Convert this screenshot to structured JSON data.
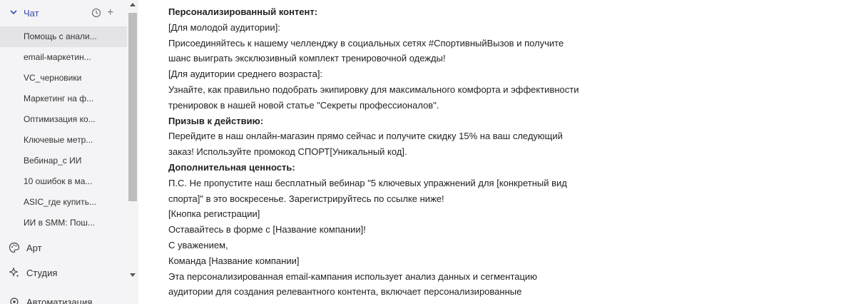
{
  "sidebar": {
    "chat_label": "Чат",
    "chat_items": [
      {
        "label": "Помощь с анали...",
        "active": true
      },
      {
        "label": "email-маркетин..."
      },
      {
        "label": "VC_черновики"
      },
      {
        "label": "Маркетинг на ф..."
      },
      {
        "label": "Оптимизация ко..."
      },
      {
        "label": "Ключевые метр..."
      },
      {
        "label": "Вебинар_с ИИ"
      },
      {
        "label": "10 ошибок в ма..."
      },
      {
        "label": "ASIC_где купить..."
      },
      {
        "label": "ИИ в SMM: Пош..."
      }
    ],
    "nav": [
      {
        "label": "Арт",
        "icon": "palette-icon"
      },
      {
        "label": "Студия",
        "icon": "sparkle-icon"
      },
      {
        "label": "Автоматизация",
        "icon": "automation-icon"
      }
    ]
  },
  "content": {
    "lines": [
      {
        "text": "Персонализированный контент:",
        "bold": true
      },
      {
        "text": "[Для молодой аудитории]:"
      },
      {
        "text": "Присоединяйтесь к нашему челленджу в социальных сетях #СпортивныйВызов и получите"
      },
      {
        "text": "шанс выиграть эксклюзивный комплект тренировочной одежды!"
      },
      {
        "text": "[Для аудитории среднего возраста]:"
      },
      {
        "text": "Узнайте, как правильно подобрать экипировку для максимального комфорта и эффективности"
      },
      {
        "text": "тренировок в нашей новой статье \"Секреты профессионалов\"."
      },
      {
        "text": "Призыв к действию:",
        "bold": true
      },
      {
        "text": "Перейдите в наш онлайн-магазин прямо сейчас и получите скидку 15% на ваш следующий"
      },
      {
        "text": "заказ! Используйте промокод СПОРТ[Уникальный код]."
      },
      {
        "text": "Дополнительная ценность:",
        "bold": true
      },
      {
        "text": "П.С. Не пропустите наш бесплатный вебинар \"5 ключевых упражнений для [конкретный вид"
      },
      {
        "text": "спорта]\" в это воскресенье. Зарегистрируйтесь по ссылке ниже!"
      },
      {
        "text": "[Кнопка регистрации]"
      },
      {
        "text": "Оставайтесь в форме с [Название компании]!"
      },
      {
        "text": "С уважением,"
      },
      {
        "text": "Команда [Название компании]"
      },
      {
        "text": "Эта персонализированная email-кампания использует анализ данных и сегментацию"
      },
      {
        "text": "аудитории для создания релевантного контента, включает персонализированные"
      }
    ]
  },
  "colors": {
    "sidebar_bg": "#f4f4f6",
    "active_item_bg": "#e4e4e8",
    "accent": "#3b4aa8",
    "scroll_thumb": "#bdbdbd"
  }
}
